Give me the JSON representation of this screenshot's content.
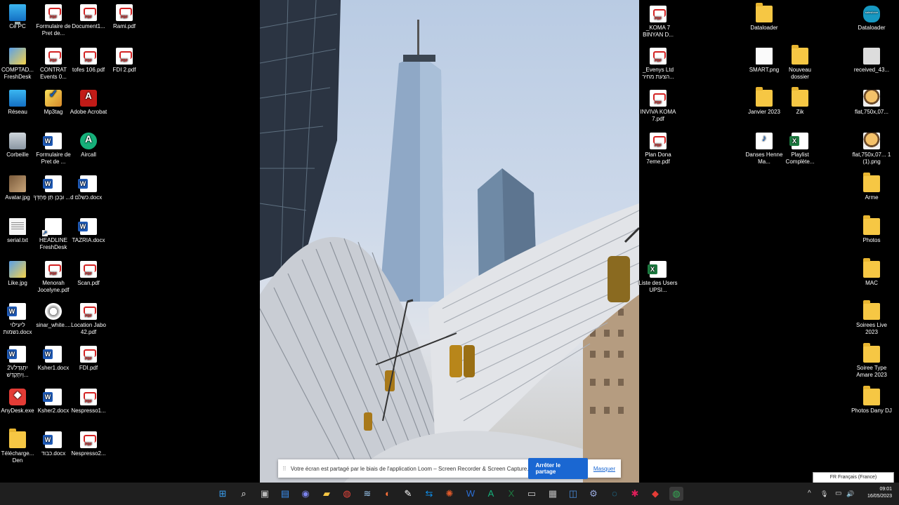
{
  "desktop": {
    "icons": [
      {
        "name": "pc-icon",
        "label": "Ce PC",
        "glyph": "g-pc"
      },
      {
        "name": "pdf-icon",
        "label": "Formulaire de Pret de...",
        "glyph": "g-pdf"
      },
      {
        "name": "pdf-icon",
        "label": "Document1...",
        "glyph": "g-pdf"
      },
      {
        "name": "pdf-icon",
        "label": "Rami.pdf",
        "glyph": "g-pdf"
      },
      {
        "name": "shortcut-icon",
        "label": "COMPTAD... FreshDesk",
        "glyph": "g-img-thumb"
      },
      {
        "name": "pdf-icon",
        "label": "CONTRAT Events 0...",
        "glyph": "g-pdf"
      },
      {
        "name": "pdf-icon",
        "label": "tofes 106.pdf",
        "glyph": "g-pdf"
      },
      {
        "name": "pdf-icon",
        "label": "FDI 2.pdf",
        "glyph": "g-pdf"
      },
      {
        "name": "network-icon",
        "label": "Réseau",
        "glyph": "g-net"
      },
      {
        "name": "mp3tag-icon",
        "label": "Mp3tag",
        "glyph": "g-mp3tag"
      },
      {
        "name": "acrobat-icon",
        "label": "Adobe Acrobat",
        "glyph": "g-acrobat"
      },
      {
        "name": "recycle-bin-icon",
        "label": "Corbeille",
        "glyph": "g-bin"
      },
      {
        "name": "word-icon",
        "label": "Formulaire de Pret de ...",
        "glyph": "g-word"
      },
      {
        "name": "aircall-icon",
        "label": "Aircall",
        "glyph": "g-app-green"
      },
      {
        "name": "image-icon",
        "label": "Avatar.jpg",
        "glyph": "g-img"
      },
      {
        "name": "word-icon",
        "label": "וּבְכֵן תֵּן פַּחְדְּךָ ...d",
        "glyph": "g-word"
      },
      {
        "name": "word-icon",
        "label": "כשלם.docx",
        "glyph": "g-word"
      },
      {
        "name": "text-file-icon",
        "label": "serial.txt",
        "glyph": "g-txt"
      },
      {
        "name": "shortcut-icon",
        "label": "HEADLINE FreshDesk",
        "glyph": "g-doc-shortcut"
      },
      {
        "name": "word-icon",
        "label": "TAZRIA.docx",
        "glyph": "g-word"
      },
      {
        "name": "image-icon",
        "label": "Like.jpg",
        "glyph": "g-img-thumb"
      },
      {
        "name": "pdf-icon",
        "label": "Menorah Jocelyne.pdf",
        "glyph": "g-pdf"
      },
      {
        "name": "pdf-icon",
        "label": "Scan.pdf",
        "glyph": "g-pdf"
      },
      {
        "name": "word-icon",
        "label": "ליעילוי נשמות.docx",
        "glyph": "g-word"
      },
      {
        "name": "image-icon",
        "label": "sinar_white....",
        "glyph": "g-sinar"
      },
      {
        "name": "pdf-icon",
        "label": "Location Jabo 42.pdf",
        "glyph": "g-pdf"
      },
      {
        "name": "word-icon",
        "label": "2Vיִתְגַּדַּל וְיִתְקַדַּשׁ...",
        "glyph": "g-word"
      },
      {
        "name": "word-icon",
        "label": "Ksher1.docx",
        "glyph": "g-word"
      },
      {
        "name": "pdf-icon",
        "label": "FDI.pdf",
        "glyph": "g-pdf"
      },
      {
        "name": "anydesk-icon",
        "label": "AnyDesk.exe",
        "glyph": "g-app-red"
      },
      {
        "name": "word-icon",
        "label": "Ksher2.docx",
        "glyph": "g-word"
      },
      {
        "name": "pdf-icon",
        "label": "Nespresso1...",
        "glyph": "g-pdf"
      },
      {
        "name": "folder-icon",
        "label": "Télécharge... Den",
        "glyph": "g-folder"
      },
      {
        "name": "word-icon",
        "label": "כבוד.docx",
        "glyph": "g-word"
      },
      {
        "name": "pdf-icon",
        "label": "Nespresso2...",
        "glyph": "g-pdf"
      },
      {
        "name": "pdf-icon",
        "label": "_KOMA 7 BINYAN D...",
        "glyph": "g-pdf"
      },
      {
        "name": "pdf-icon",
        "label": "_Evenys Ltd הצעת מחיר...",
        "glyph": "g-pdf"
      },
      {
        "name": "pdf-icon",
        "label": "INVIVA KOMA 7.pdf",
        "glyph": "g-pdf"
      },
      {
        "name": "pdf-icon",
        "label": "Plan Dona 7eme.pdf",
        "glyph": "g-pdf"
      },
      {
        "name": "excel-icon",
        "label": "Liste des Users UPSI...",
        "glyph": "g-excel"
      },
      {
        "name": "folder-icon",
        "label": "Dataloader",
        "glyph": "g-folder"
      },
      {
        "name": "image-icon",
        "label": "SMART.png",
        "glyph": "g-png"
      },
      {
        "name": "folder-icon",
        "label": "Nouveau dossier",
        "glyph": "g-folder"
      },
      {
        "name": "folder-icon",
        "label": "Janvier 2023",
        "glyph": "g-folder"
      },
      {
        "name": "folder-icon",
        "label": "Zik",
        "glyph": "g-folder"
      },
      {
        "name": "audio-file-icon",
        "label": "Danses Henne Ma...",
        "glyph": "g-audio"
      },
      {
        "name": "excel-icon",
        "label": "Playlist Complète...",
        "glyph": "g-excel"
      },
      {
        "name": "salesforce-icon",
        "label": "Dataloader",
        "glyph": "g-sf"
      },
      {
        "name": "video-icon",
        "label": "received_43...",
        "glyph": "g-video"
      },
      {
        "name": "image-icon",
        "label": "flat,750x,07...",
        "glyph": "g-sticker"
      },
      {
        "name": "image-icon",
        "label": "flat,750x,07... 1 (1).png",
        "glyph": "g-sticker"
      },
      {
        "name": "folder-icon",
        "label": "Arme",
        "glyph": "g-folder"
      },
      {
        "name": "folder-icon",
        "label": "Photos",
        "glyph": "g-folder"
      },
      {
        "name": "folder-icon",
        "label": "MAC",
        "glyph": "g-folder"
      },
      {
        "name": "folder-icon",
        "label": "Soirees Live 2023",
        "glyph": "g-folder"
      },
      {
        "name": "folder-icon",
        "label": "Soiree Type Amare 2023",
        "glyph": "g-folder"
      },
      {
        "name": "folder-icon",
        "label": "Photos Dany DJ",
        "glyph": "g-folder"
      }
    ]
  },
  "share_bar": {
    "grip": "⠿",
    "message": "Votre écran est partagé par le biais de l'application Loom – Screen Recorder & Screen Capture.",
    "stop_label": "Arrêter le partage",
    "hide_label": "Masquer"
  },
  "language_tooltip": "FR Français (France)",
  "taskbar": {
    "apps": [
      {
        "name": "start-button-icon",
        "glyph": "⊞",
        "color": "#3aa0f2"
      },
      {
        "name": "search-icon",
        "glyph": "⌕",
        "color": "#ffffff"
      },
      {
        "name": "task-view-icon",
        "glyph": "▣",
        "color": "#bbbbbb"
      },
      {
        "name": "widgets-icon",
        "glyph": "▤",
        "color": "#3a8ef0"
      },
      {
        "name": "teams-chat-icon",
        "glyph": "◉",
        "color": "#7b83eb"
      },
      {
        "name": "file-explorer-icon",
        "glyph": "▰",
        "color": "#f6c744"
      },
      {
        "name": "chrome-icon",
        "glyph": "◍",
        "color": "#e8453c"
      },
      {
        "name": "network-tool-icon",
        "glyph": "≋",
        "color": "#9ac8f0"
      },
      {
        "name": "firefox-icon",
        "glyph": "◐",
        "color": "#ff7139"
      },
      {
        "name": "notepad-icon",
        "glyph": "✎",
        "color": "#ffffff"
      },
      {
        "name": "teamviewer-icon",
        "glyph": "⇆",
        "color": "#0e8ee9"
      },
      {
        "name": "settings-app-icon",
        "glyph": "✺",
        "color": "#e05a2a"
      },
      {
        "name": "word-taskbar-icon",
        "glyph": "W",
        "color": "#2b6fd6"
      },
      {
        "name": "aircall-taskbar-icon",
        "glyph": "A",
        "color": "#16b07a"
      },
      {
        "name": "excel-taskbar-icon",
        "glyph": "X",
        "color": "#1d7a40"
      },
      {
        "name": "terminal-icon",
        "glyph": "▭",
        "color": "#cccccc"
      },
      {
        "name": "calculator-icon",
        "glyph": "▦",
        "color": "#bbbbbb"
      },
      {
        "name": "remote-desktop-icon",
        "glyph": "◫",
        "color": "#4a90e2"
      },
      {
        "name": "control-panel-icon",
        "glyph": "⚙",
        "color": "#9ad"
      },
      {
        "name": "edge-icon",
        "glyph": "◌",
        "color": "#1fa7e0"
      },
      {
        "name": "slack-icon",
        "glyph": "✱",
        "color": "#e01e5a"
      },
      {
        "name": "anydesk-taskbar-icon",
        "glyph": "◆",
        "color": "#e43c36"
      },
      {
        "name": "chrome-active-icon",
        "glyph": "◍",
        "color": "#34a853"
      }
    ],
    "tray": {
      "chevron": "^",
      "mic": "🎙",
      "display": "▭",
      "speaker": "🔊"
    },
    "time": "09:01",
    "date": "16/05/2023"
  }
}
